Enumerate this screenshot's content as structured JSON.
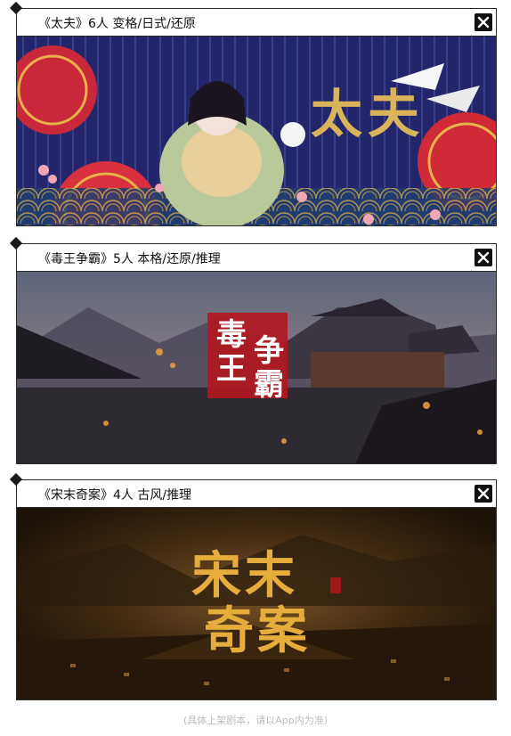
{
  "scripts": [
    {
      "title": "《太夫》6人 变格/日式/还原",
      "banner_text": "太夫",
      "theme": "#22255c"
    },
    {
      "title": "《毒王争霸》5人 本格/还原/推理",
      "banner_text_1": "毒王",
      "banner_text_2": "争霸",
      "theme": "#3b3a4a"
    },
    {
      "title": "《宋末奇案》4人 古风/推理",
      "banner_text_1": "宋末",
      "banner_text_2": "奇案",
      "theme": "#2a1d10"
    }
  ],
  "icons": {
    "close": "close-icon",
    "marker": "diamond-marker-icon"
  },
  "footer_note": "(具体上架剧本，请以App内为准)"
}
